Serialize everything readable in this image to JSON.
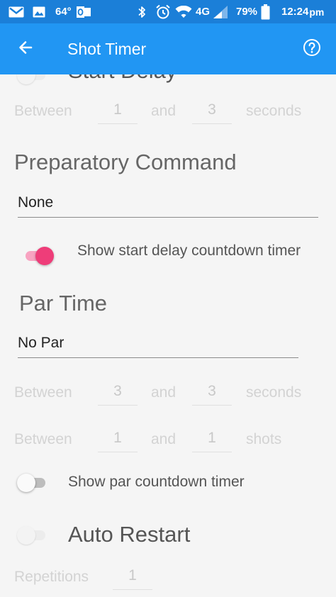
{
  "status_bar": {
    "temperature": "64°",
    "network": "4G",
    "battery_percent": "79%",
    "time": "12:24",
    "time_suffix": "pm"
  },
  "app_bar": {
    "title": "Shot Timer",
    "back_icon": "arrow-back-icon",
    "help_icon": "help-circle-icon"
  },
  "start_delay": {
    "label": "Start Delay",
    "row": {
      "between": "Between",
      "min": "1",
      "and": "and",
      "max": "3",
      "unit": "seconds"
    }
  },
  "preparatory_command": {
    "heading": "Preparatory Command",
    "value": "None"
  },
  "show_start_delay": {
    "label": "Show start delay countdown timer",
    "enabled": true
  },
  "par_time": {
    "heading": "Par Time",
    "value": "No Par",
    "seconds_row": {
      "between": "Between",
      "min": "3",
      "and": "and",
      "max": "3",
      "unit": "seconds"
    },
    "shots_row": {
      "between": "Between",
      "min": "1",
      "and": "and",
      "max": "1",
      "unit": "shots"
    }
  },
  "show_par_countdown": {
    "label": "Show par countdown timer",
    "enabled": false
  },
  "auto_restart": {
    "label": "Auto Restart",
    "enabled": false,
    "repetitions_label": "Repetitions",
    "repetitions_value": "1"
  },
  "colors": {
    "status_bar": "#1b7fd8",
    "app_bar": "#2196f3",
    "accent": "#ee3d79",
    "background": "#f5f5f5"
  }
}
